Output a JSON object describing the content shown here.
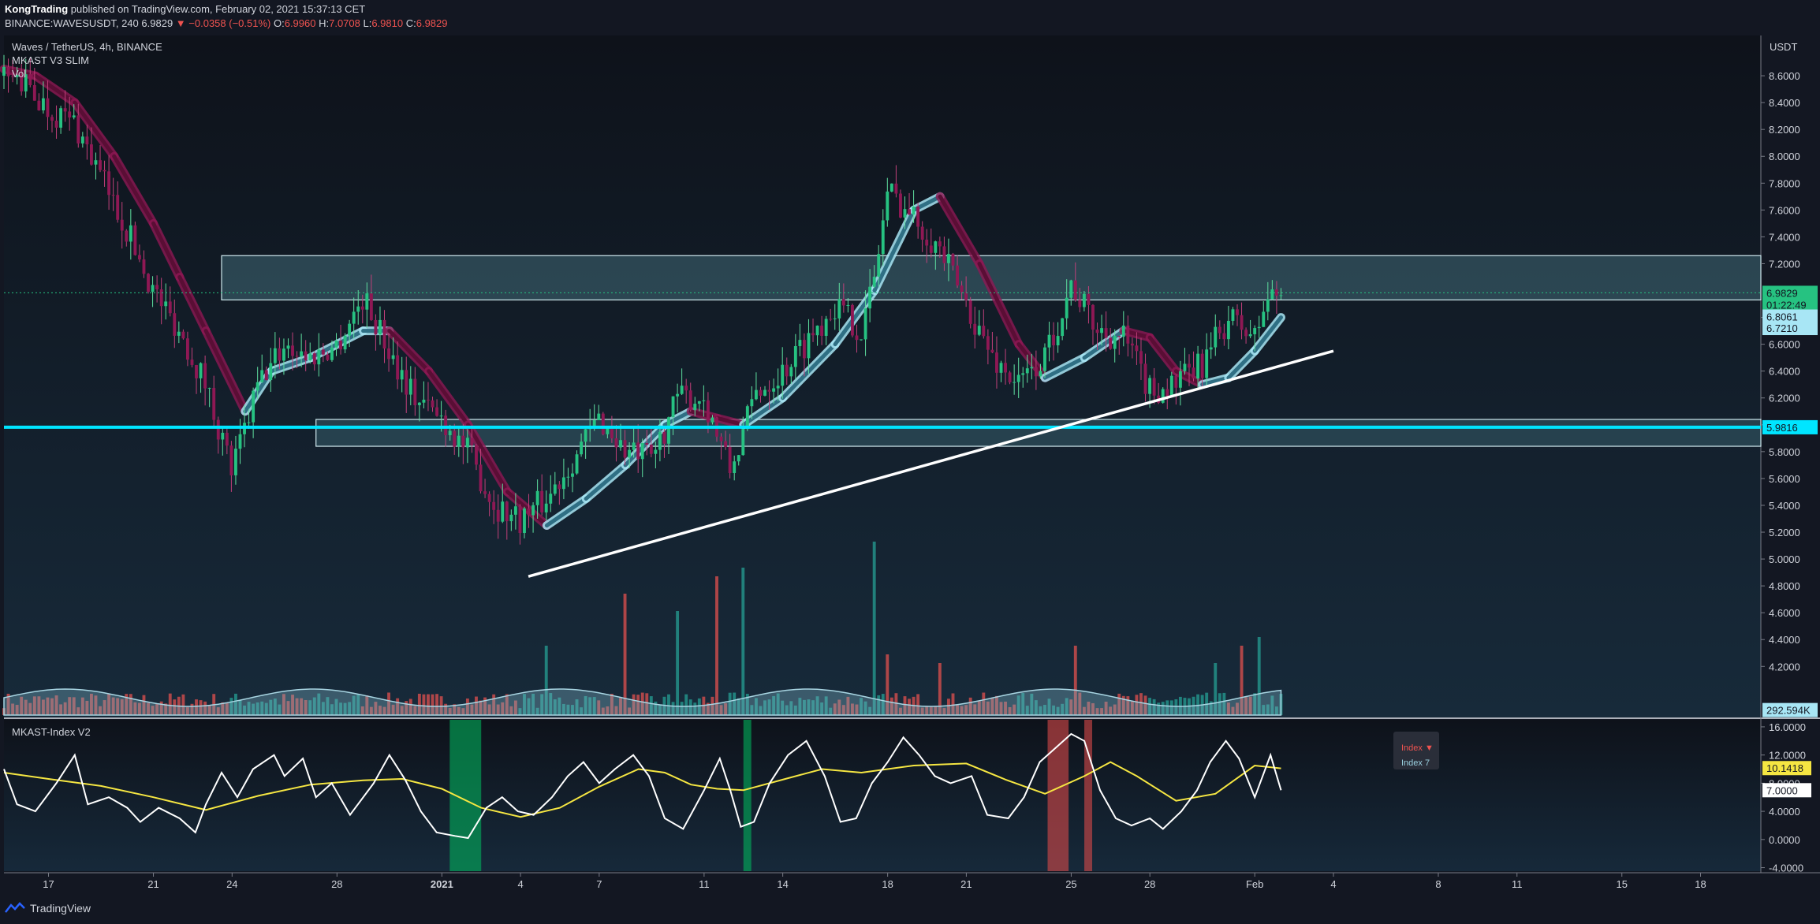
{
  "header": {
    "author": "KongTrading",
    "published": "published on TradingView.com, February 02, 2021 15:37:13 CET",
    "symbol_line": "BINANCE:WAVESUSDT, 240",
    "last": "6.9829",
    "change": "−0.0358 (−0.51%)",
    "o_label": "O:",
    "o": "6.9960",
    "h_label": "H:",
    "h": "7.0708",
    "l_label": "L:",
    "l": "6.9810",
    "c_label": "C:",
    "c": "6.9829"
  },
  "legend": {
    "title": "Waves / TetherUS, 4h, BINANCE",
    "indicator": "MKAST V3 SLIM",
    "vol": "Vol"
  },
  "indicator_pane": {
    "title": "MKAST-Index V2",
    "tooltip_line1": "Index ▼",
    "tooltip_line2": "Index 7"
  },
  "footer": {
    "brand": "TradingView"
  },
  "chart_data": {
    "type": "candlestick",
    "title": "Waves / TetherUS, 4h, BINANCE",
    "currency": "USDT",
    "price_axis": {
      "ylim": [
        3.82,
        8.9
      ],
      "ticks": [
        "8.6000",
        "8.4000",
        "8.2000",
        "8.0000",
        "7.8000",
        "7.6000",
        "7.4000",
        "7.2000",
        "6.8000",
        "6.6000",
        "6.4000",
        "6.2000",
        "6.0000",
        "5.8000",
        "5.6000",
        "5.4000",
        "5.2000",
        "5.0000",
        "4.8000",
        "4.6000",
        "4.4000",
        "4.2000"
      ],
      "labels": [
        {
          "text": "6.9829",
          "value": 6.9829,
          "color": "#26c281",
          "text_color": "#131722"
        },
        {
          "text": "01:22:49",
          "value": 6.895,
          "color": "#26c281",
          "text_color": "#131722"
        },
        {
          "text": "6.8061",
          "value": 6.8061,
          "color": "#a8e6f5",
          "text_color": "#131722"
        },
        {
          "text": "6.7210",
          "value": 6.721,
          "color": "#a8e6f5",
          "text_color": "#131722"
        },
        {
          "text": "5.9816",
          "value": 5.9816,
          "color": "#00e5ff",
          "text_color": "#131722"
        },
        {
          "text": "292.594K",
          "value": 3.875,
          "color": "#a8e6f5",
          "text_color": "#131722"
        }
      ]
    },
    "time_axis": {
      "ticks": [
        {
          "label": "17",
          "day": 2
        },
        {
          "label": "21",
          "day": 6
        },
        {
          "label": "24",
          "day": 9
        },
        {
          "label": "28",
          "day": 13
        },
        {
          "label": "2021",
          "day": 17,
          "bold": true
        },
        {
          "label": "4",
          "day": 20
        },
        {
          "label": "7",
          "day": 23
        },
        {
          "label": "11",
          "day": 27
        },
        {
          "label": "14",
          "day": 30
        },
        {
          "label": "18",
          "day": 34
        },
        {
          "label": "21",
          "day": 37
        },
        {
          "label": "25",
          "day": 41
        },
        {
          "label": "28",
          "day": 44
        },
        {
          "label": "Feb",
          "day": 48
        },
        {
          "label": "4",
          "day": 51
        },
        {
          "label": "8",
          "day": 55
        },
        {
          "label": "11",
          "day": 58
        },
        {
          "label": "15",
          "day": 62
        },
        {
          "label": "18",
          "day": 65
        }
      ],
      "day_range": [
        0.3,
        67.3
      ],
      "last_candle_day": 49.0
    },
    "resistance_zone": [
      6.93,
      7.26
    ],
    "support_zone": [
      5.84,
      6.04
    ],
    "support_line": 5.9816,
    "trendline": [
      {
        "day": 20.3,
        "price": 4.87
      },
      {
        "day": 51,
        "price": 6.55
      }
    ],
    "price_path": [
      [
        0.3,
        8.6
      ],
      [
        1,
        8.55
      ],
      [
        2,
        8.35
      ],
      [
        3,
        8.25
      ],
      [
        4,
        7.85
      ],
      [
        5,
        7.45
      ],
      [
        6,
        7.0
      ],
      [
        7,
        6.7
      ],
      [
        8,
        6.3
      ],
      [
        9,
        5.65
      ],
      [
        10,
        6.3
      ],
      [
        11,
        6.6
      ],
      [
        12,
        6.5
      ],
      [
        13,
        6.6
      ],
      [
        14,
        6.95
      ],
      [
        15,
        6.55
      ],
      [
        16,
        6.2
      ],
      [
        17,
        6.05
      ],
      [
        18,
        5.8
      ],
      [
        19,
        5.4
      ],
      [
        20,
        5.3
      ],
      [
        21,
        5.45
      ],
      [
        22,
        5.75
      ],
      [
        23,
        6.05
      ],
      [
        24,
        5.8
      ],
      [
        25,
        5.75
      ],
      [
        26,
        6.2
      ],
      [
        27,
        6.2
      ],
      [
        28,
        5.65
      ],
      [
        29,
        6.25
      ],
      [
        30,
        6.4
      ],
      [
        31,
        6.65
      ],
      [
        32,
        6.9
      ],
      [
        33,
        6.7
      ],
      [
        33.5,
        7.1
      ],
      [
        34,
        7.75
      ],
      [
        35,
        7.55
      ],
      [
        36,
        7.3
      ],
      [
        37,
        6.9
      ],
      [
        38,
        6.5
      ],
      [
        39,
        6.3
      ],
      [
        40,
        6.5
      ],
      [
        41,
        7.05
      ],
      [
        42,
        6.7
      ],
      [
        43,
        6.65
      ],
      [
        44,
        6.25
      ],
      [
        45,
        6.3
      ],
      [
        46,
        6.45
      ],
      [
        47,
        6.8
      ],
      [
        48,
        6.65
      ],
      [
        48.5,
        6.95
      ],
      [
        49,
        6.98
      ]
    ],
    "ma_band": {
      "slow_path": [
        [
          0.3,
          8.65
        ],
        [
          1.5,
          8.6
        ],
        [
          3,
          8.4
        ],
        [
          4.5,
          8.0
        ],
        [
          6,
          7.5
        ],
        [
          7,
          7.1
        ],
        [
          8,
          6.7
        ],
        [
          9.5,
          6.1
        ],
        [
          10.5,
          6.4
        ],
        [
          12,
          6.5
        ],
        [
          14,
          6.7
        ],
        [
          15,
          6.7
        ],
        [
          16.5,
          6.4
        ],
        [
          18,
          6.0
        ],
        [
          19.5,
          5.5
        ],
        [
          21,
          5.25
        ],
        [
          22.5,
          5.45
        ],
        [
          24,
          5.7
        ],
        [
          25.5,
          6.0
        ],
        [
          26.5,
          6.1
        ],
        [
          27.5,
          6.05
        ],
        [
          28.5,
          6.0
        ],
        [
          30,
          6.2
        ],
        [
          32,
          6.6
        ],
        [
          33.5,
          7.0
        ],
        [
          35,
          7.6
        ],
        [
          36,
          7.7
        ],
        [
          37.5,
          7.2
        ],
        [
          39,
          6.6
        ],
        [
          40,
          6.35
        ],
        [
          41.5,
          6.5
        ],
        [
          43,
          6.7
        ],
        [
          44,
          6.65
        ],
        [
          45,
          6.4
        ],
        [
          46,
          6.3
        ],
        [
          47,
          6.35
        ],
        [
          48,
          6.55
        ],
        [
          49,
          6.8
        ]
      ],
      "up_color": "#a8e6f5",
      "down_color": "#8e1854"
    },
    "candles_approx": "generated along price_path",
    "volume": {
      "label": "Vol",
      "last": "292.594K",
      "spikes": [
        [
          21,
          0.4
        ],
        [
          24,
          0.7
        ],
        [
          26,
          0.6
        ],
        [
          27.5,
          0.8
        ],
        [
          28.5,
          0.85
        ],
        [
          33.5,
          1.0
        ],
        [
          34,
          0.35
        ],
        [
          36,
          0.3
        ],
        [
          41.2,
          0.4
        ],
        [
          46.5,
          0.3
        ],
        [
          47.5,
          0.4
        ],
        [
          48.2,
          0.45
        ]
      ]
    },
    "index_pane": {
      "ylim": [
        -4.5,
        17
      ],
      "ticks": [
        "16.0000",
        "12.0000",
        "8.0000",
        "4.0000",
        "0.0000",
        "-4.0000"
      ],
      "labels": [
        {
          "text": "10.1418",
          "value": 10.1418,
          "color": "#f5e642"
        },
        {
          "text": "7.0000",
          "value": 7.0,
          "color": "#ffffff"
        }
      ],
      "index_path": [
        [
          0.3,
          10
        ],
        [
          0.8,
          5
        ],
        [
          1.5,
          4
        ],
        [
          2.3,
          8
        ],
        [
          3,
          12
        ],
        [
          3.5,
          5
        ],
        [
          4.3,
          6
        ],
        [
          5,
          4.5
        ],
        [
          5.5,
          2.5
        ],
        [
          6.2,
          4.5
        ],
        [
          7,
          3
        ],
        [
          7.6,
          1
        ],
        [
          8,
          5
        ],
        [
          8.6,
          9.5
        ],
        [
          9.2,
          6
        ],
        [
          9.8,
          10
        ],
        [
          10.6,
          12
        ],
        [
          11,
          9
        ],
        [
          11.7,
          11.5
        ],
        [
          12.2,
          6
        ],
        [
          12.8,
          8
        ],
        [
          13.5,
          3.5
        ],
        [
          14.4,
          8
        ],
        [
          15,
          12
        ],
        [
          15.6,
          8.5
        ],
        [
          16.2,
          4
        ],
        [
          16.8,
          1
        ],
        [
          17.5,
          0.5
        ],
        [
          18,
          0.2
        ],
        [
          18.7,
          4.5
        ],
        [
          19.3,
          6
        ],
        [
          19.9,
          4
        ],
        [
          20.5,
          3.5
        ],
        [
          21.2,
          6
        ],
        [
          21.8,
          9
        ],
        [
          22.4,
          11
        ],
        [
          23,
          8
        ],
        [
          23.6,
          10
        ],
        [
          24.3,
          12
        ],
        [
          24.9,
          9
        ],
        [
          25.5,
          3
        ],
        [
          26.2,
          1.5
        ],
        [
          27,
          7
        ],
        [
          27.6,
          11.5
        ],
        [
          28,
          7
        ],
        [
          28.4,
          1.8
        ],
        [
          28.9,
          2.5
        ],
        [
          29.5,
          8
        ],
        [
          30.2,
          12
        ],
        [
          30.9,
          14
        ],
        [
          31.6,
          9
        ],
        [
          32.2,
          2.5
        ],
        [
          32.8,
          3
        ],
        [
          33.4,
          8
        ],
        [
          34,
          11
        ],
        [
          34.6,
          14.5
        ],
        [
          35.2,
          12
        ],
        [
          35.8,
          9
        ],
        [
          36.4,
          8
        ],
        [
          37.2,
          9
        ],
        [
          37.8,
          3.5
        ],
        [
          38.6,
          3
        ],
        [
          39.2,
          6
        ],
        [
          39.8,
          11
        ],
        [
          40.4,
          13
        ],
        [
          41,
          15
        ],
        [
          41.5,
          14
        ],
        [
          42.1,
          7
        ],
        [
          42.7,
          3
        ],
        [
          43.3,
          2
        ],
        [
          44,
          3
        ],
        [
          44.5,
          1.5
        ],
        [
          45.2,
          4
        ],
        [
          45.8,
          7
        ],
        [
          46.3,
          11
        ],
        [
          46.9,
          14
        ],
        [
          47.4,
          11.5
        ],
        [
          48,
          6
        ],
        [
          48.6,
          12
        ],
        [
          49,
          7
        ]
      ],
      "signal_path": [
        [
          0.3,
          9.5
        ],
        [
          2,
          8.6
        ],
        [
          4,
          7.6
        ],
        [
          6,
          6.0
        ],
        [
          8,
          4.2
        ],
        [
          10,
          6.2
        ],
        [
          12,
          7.8
        ],
        [
          14,
          8.4
        ],
        [
          15.5,
          8.6
        ],
        [
          17,
          7.2
        ],
        [
          18.5,
          4.5
        ],
        [
          20,
          3.2
        ],
        [
          21.5,
          4.5
        ],
        [
          23,
          7.5
        ],
        [
          24.5,
          10
        ],
        [
          25.5,
          9.5
        ],
        [
          26.5,
          7.8
        ],
        [
          27.5,
          7.2
        ],
        [
          28.5,
          7.0
        ],
        [
          30,
          8.5
        ],
        [
          31.5,
          10
        ],
        [
          33,
          9.5
        ],
        [
          35,
          10.5
        ],
        [
          37,
          10.8
        ],
        [
          38.5,
          8.5
        ],
        [
          40,
          6.5
        ],
        [
          41.5,
          9
        ],
        [
          42.5,
          11
        ],
        [
          43.5,
          9
        ],
        [
          45,
          5.5
        ],
        [
          46.5,
          6.5
        ],
        [
          48,
          10.5
        ],
        [
          49,
          10.1
        ]
      ],
      "highlights": [
        {
          "from": 17.3,
          "to": 18.5,
          "color": "#00c060",
          "opacity": 0.55
        },
        {
          "from": 28.5,
          "to": 28.8,
          "color": "#00c060",
          "opacity": 0.55
        },
        {
          "from": 40.1,
          "to": 40.9,
          "color": "#d94a4a",
          "opacity": 0.6
        },
        {
          "from": 41.5,
          "to": 41.8,
          "color": "#d94a4a",
          "opacity": 0.6
        }
      ]
    }
  },
  "colors": {
    "bg": "#131722",
    "up": "#26c281",
    "down": "#8e1854",
    "zone": "#6fb7c4",
    "support": "#00e5ff",
    "signal": "#f5e642"
  }
}
